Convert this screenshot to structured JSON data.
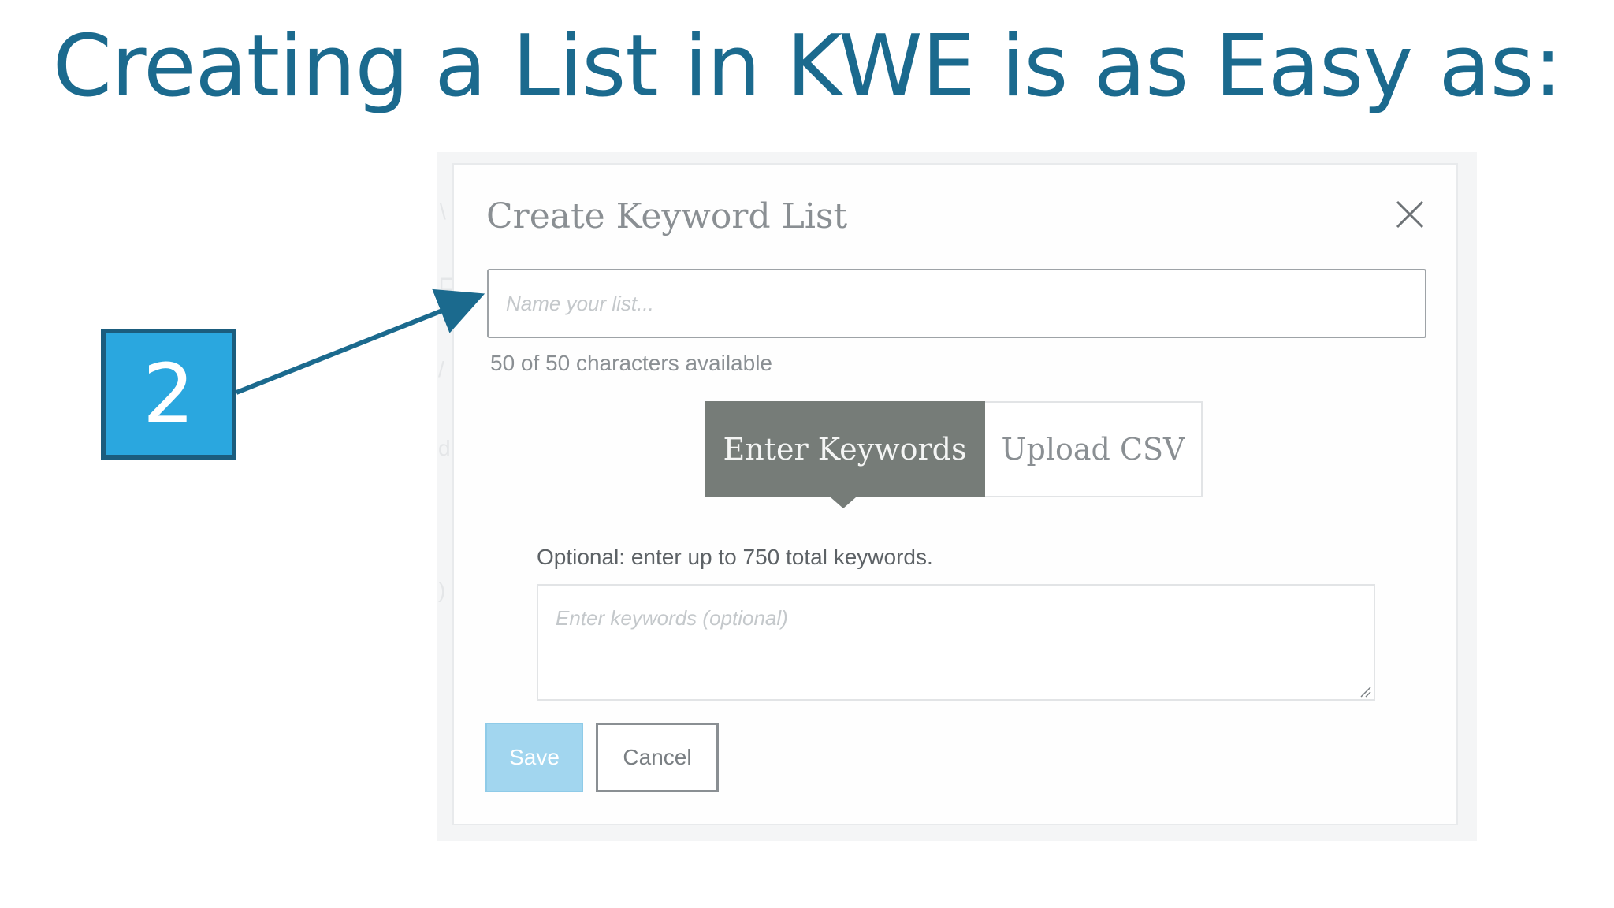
{
  "slide": {
    "title": "Creating a List in KWE is as Easy as:",
    "step_number": "2",
    "colors": {
      "title": "#1b6a8e",
      "badge_fill": "#2aa7df",
      "badge_border": "#1b5d7e",
      "arrow": "#1b6a8e"
    }
  },
  "modal": {
    "title": "Create Keyword List",
    "close_icon": "close-icon",
    "name_input": {
      "value": "",
      "placeholder": "Name your list..."
    },
    "char_count": "50 of 50 characters available",
    "tabs": [
      {
        "label": "Enter Keywords",
        "active": true
      },
      {
        "label": "Upload CSV",
        "active": false
      }
    ],
    "optional_hint": "Optional: enter up to 750 total keywords.",
    "keywords_textarea": {
      "value": "",
      "placeholder": "Enter keywords (optional)"
    },
    "buttons": {
      "save_label": "Save",
      "cancel_label": "Cancel"
    },
    "colors": {
      "active_tab": "#767c78",
      "save_button": "#a2d6ef"
    }
  }
}
